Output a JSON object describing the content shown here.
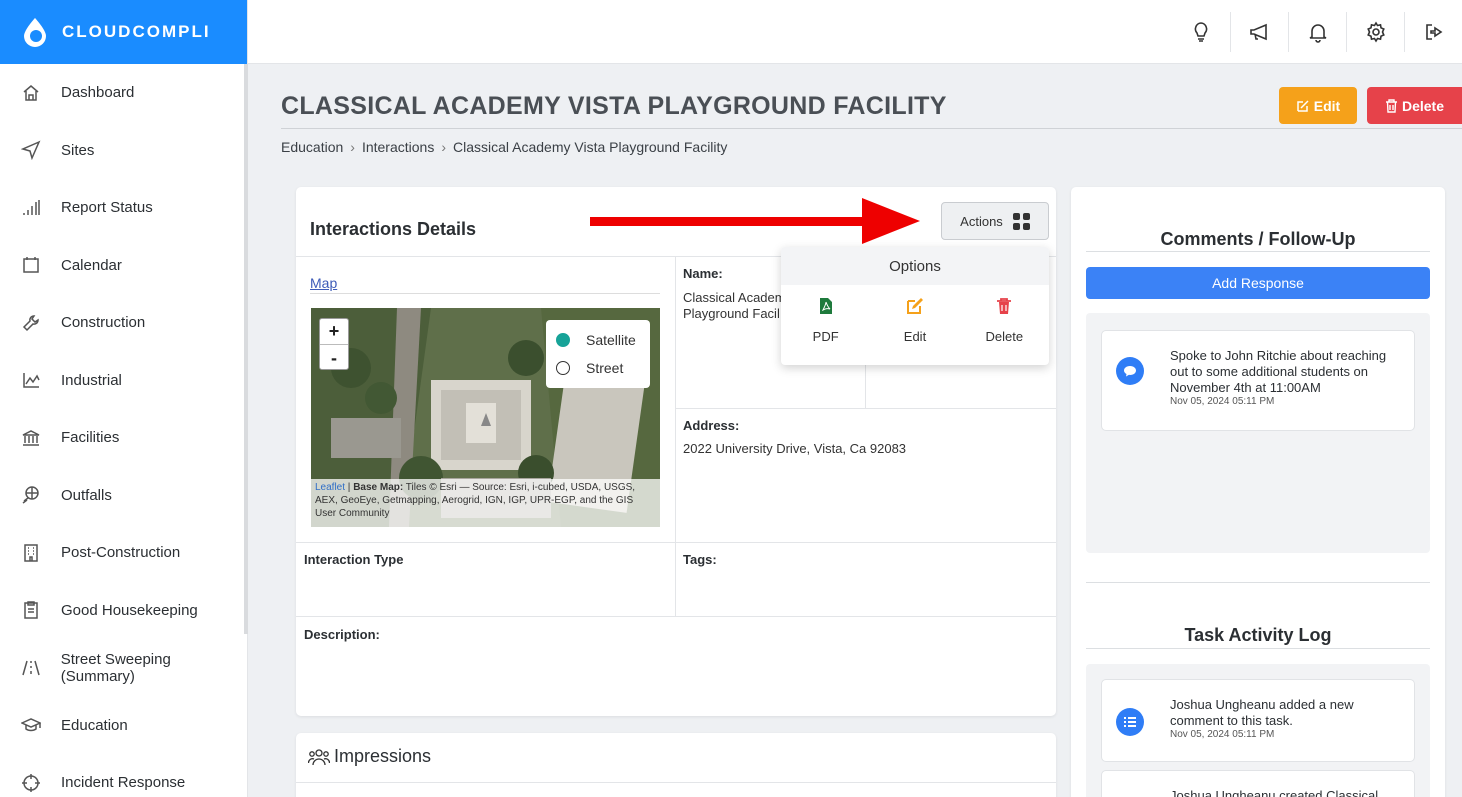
{
  "brand": {
    "name": "CLOUDCOMPLI",
    "color": "#1a8cff"
  },
  "sidebar": {
    "items": [
      {
        "label": "Dashboard",
        "icon": "home-icon"
      },
      {
        "label": "Sites",
        "icon": "navigation-arrow-icon"
      },
      {
        "label": "Report Status",
        "icon": "signal-bars-icon"
      },
      {
        "label": "Calendar",
        "icon": "calendar-icon"
      },
      {
        "label": "Construction",
        "icon": "wrench-icon"
      },
      {
        "label": "Industrial",
        "icon": "line-chart-icon"
      },
      {
        "label": "Facilities",
        "icon": "bank-icon"
      },
      {
        "label": "Outfalls",
        "icon": "pipe-icon"
      },
      {
        "label": "Post-Construction",
        "icon": "building-icon"
      },
      {
        "label": "Good Housekeeping",
        "icon": "clipboard-icon"
      },
      {
        "label": "Street Sweeping (Summary)",
        "icon": "road-icon"
      },
      {
        "label": "Education",
        "icon": "graduation-cap-icon"
      },
      {
        "label": "Incident Response",
        "icon": "crosshair-icon"
      }
    ]
  },
  "topbar": {
    "icons": [
      "lightbulb-icon",
      "megaphone-icon",
      "bell-icon",
      "gear-icon",
      "logout-icon"
    ]
  },
  "header": {
    "title": "CLASSICAL ACADEMY VISTA PLAYGROUND FACILITY",
    "breadcrumb": [
      "Education",
      "Interactions",
      "Classical Academy Vista Playground Facility"
    ],
    "edit_label": "Edit",
    "delete_label": "Delete",
    "edit_color": "#f5a11a",
    "delete_color": "#e6424a"
  },
  "details": {
    "title": "Interactions Details",
    "actions_label": "Actions",
    "map_link": "Map",
    "map": {
      "zoom_in": "+",
      "zoom_out": "-",
      "layers": [
        "Satellite",
        "Street"
      ],
      "selected_layer": "Satellite",
      "attribution_leaflet": "Leaflet",
      "attribution_sep": " | ",
      "attribution_bold": "Base Map:",
      "attribution_text": " Tiles © Esri — Source: Esri, i-cubed, USDA, USGS, AEX, GeoEye, Getmapping, Aerogrid, IGN, IGP, UPR-EGP, and the GIS User Community"
    },
    "name_label": "Name:",
    "name_line1": "Classical Academ",
    "name_line2": "Playground Facil",
    "address_label": "Address:",
    "address_value": "2022 University Drive, Vista, Ca 92083",
    "interaction_type_label": "Interaction Type",
    "tags_label": "Tags:",
    "description_label": "Description:"
  },
  "options_menu": {
    "title": "Options",
    "items": [
      {
        "label": "PDF",
        "icon": "pdf-icon",
        "color": "#1e7a3c"
      },
      {
        "label": "Edit",
        "icon": "edit-icon",
        "color": "#f5a11a"
      },
      {
        "label": "Delete",
        "icon": "trash-icon",
        "color": "#e6424a"
      }
    ]
  },
  "impressions": {
    "title": "Impressions"
  },
  "comments": {
    "title": "Comments / Follow-Up",
    "add_label": "Add Response",
    "entries": [
      {
        "text": "Spoke to John Ritchie about reaching out to some additional students on November 4th at 11:00AM",
        "time": "Nov 05, 2024 05:11 PM"
      }
    ]
  },
  "activity": {
    "title": "Task Activity Log",
    "entries": [
      {
        "text": "Joshua Ungheanu added a new comment to this task.",
        "time": "Nov 05, 2024 05:11 PM"
      },
      {
        "text": "Joshua Ungheanu created Classical",
        "time": ""
      }
    ]
  }
}
